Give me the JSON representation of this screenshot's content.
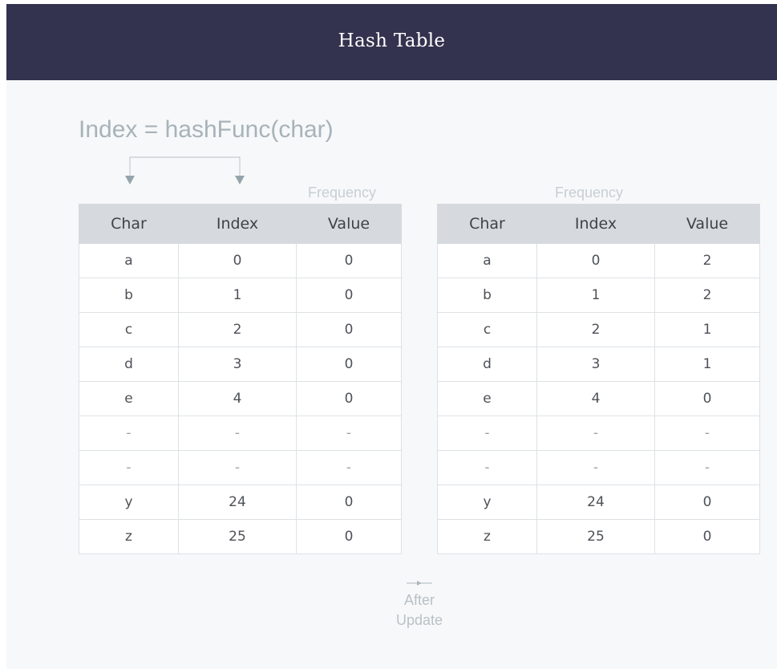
{
  "header": {
    "title": "Hash Table"
  },
  "formula": "Index = hashFunc(char)",
  "tables": {
    "left": {
      "frequency_label": "Frequency",
      "columns": [
        "Char",
        "Index",
        "Value"
      ],
      "rows": [
        [
          "a",
          "0",
          "0"
        ],
        [
          "b",
          "1",
          "0"
        ],
        [
          "c",
          "2",
          "0"
        ],
        [
          "d",
          "3",
          "0"
        ],
        [
          "e",
          "4",
          "0"
        ],
        [
          "-",
          "-",
          "-"
        ],
        [
          "-",
          "-",
          "-"
        ],
        [
          "y",
          "24",
          "0"
        ],
        [
          "z",
          "25",
          "0"
        ]
      ]
    },
    "right": {
      "frequency_label": "Frequency",
      "columns": [
        "Char",
        "Index",
        "Value"
      ],
      "rows": [
        [
          "a",
          "0",
          "2"
        ],
        [
          "b",
          "1",
          "2"
        ],
        [
          "c",
          "2",
          "1"
        ],
        [
          "d",
          "3",
          "1"
        ],
        [
          "e",
          "4",
          "0"
        ],
        [
          "-",
          "-",
          "-"
        ],
        [
          "-",
          "-",
          "-"
        ],
        [
          "y",
          "24",
          "0"
        ],
        [
          "z",
          "25",
          "0"
        ]
      ]
    }
  },
  "transition": {
    "line1": "After",
    "line2": "Update"
  },
  "colors": {
    "header_bg": "#33334f",
    "header_text": "#ffffff",
    "table_header_bg": "#d6dade",
    "border": "#dde2e5",
    "muted_text": "#a7b3b9"
  }
}
